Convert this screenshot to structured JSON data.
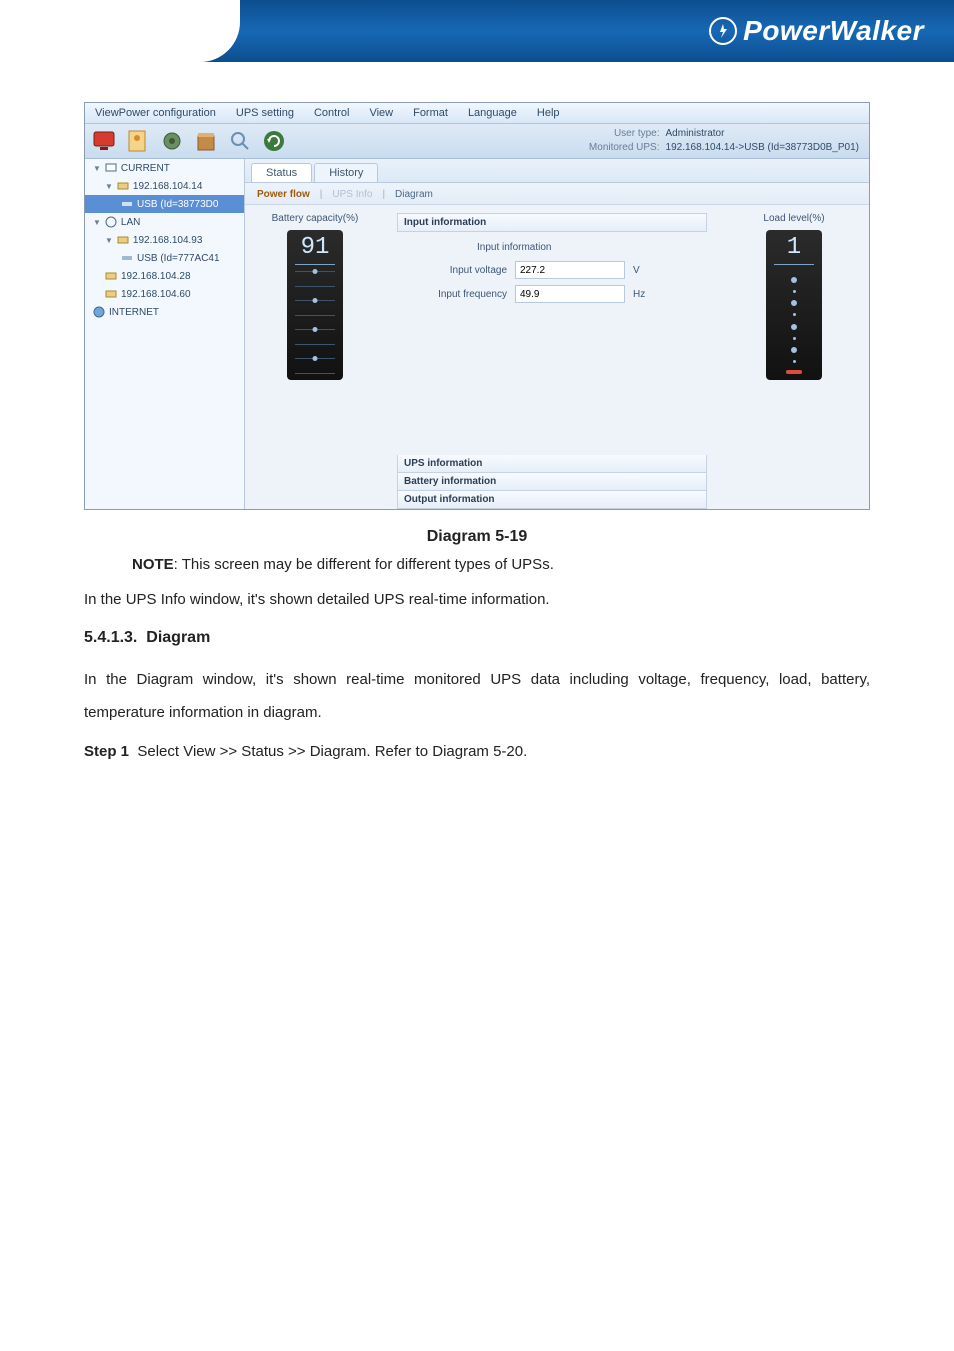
{
  "brand": {
    "name": "PowerWalker"
  },
  "app": {
    "menubar": [
      "ViewPower configuration",
      "UPS setting",
      "Control",
      "View",
      "Format",
      "Language",
      "Help"
    ],
    "user_type_label": "User type:",
    "user_type_value": "Administrator",
    "mon_label": "Monitored UPS:",
    "mon_value": "192.168.104.14->USB (Id=38773D0B_P01)",
    "tree": {
      "current": "CURRENT",
      "ip1": "192.168.104.14",
      "usb1": "USB (Id=38773D0",
      "lan": "LAN",
      "ip2": "192.168.104.93",
      "usb2": "USB (Id=777AC41",
      "ip3": "192.168.104.28",
      "ip4": "192.168.104.60",
      "internet": "INTERNET"
    },
    "tabs_a": {
      "status": "Status",
      "history": "History"
    },
    "tabs_b": {
      "powerflow": "Power flow",
      "upsinfo": "UPS Info",
      "diagram": "Diagram"
    },
    "battery_capacity_label": "Battery capacity(%)",
    "battery_capacity_value": "91",
    "load_label": "Load level(%)",
    "load_value": "1",
    "accordion": {
      "input_header": "Input information",
      "input_title": "Input information",
      "voltage_label": "Input voltage",
      "voltage_value": "227.2",
      "voltage_unit": "V",
      "freq_label": "Input frequency",
      "freq_value": "49.9",
      "freq_unit": "Hz",
      "ups_header": "UPS information",
      "batt_header": "Battery information",
      "output_header": "Output information"
    }
  },
  "doc": {
    "caption": "Diagram 5-19",
    "note_bold": "NOTE",
    "note_text": ": This screen may be different for different types of UPSs.",
    "para1": "In the UPS Info window, it's shown detailed UPS real-time information.",
    "h3_num": "5.4.1.3.",
    "h3_text": "Diagram",
    "para2": "In the Diagram window, it's shown real-time monitored UPS data including voltage, frequency, load, battery, temperature information in diagram.",
    "step_bold": "Step 1",
    "step_text": "Select View >> Status >> Diagram. Refer to Diagram 5-20."
  }
}
